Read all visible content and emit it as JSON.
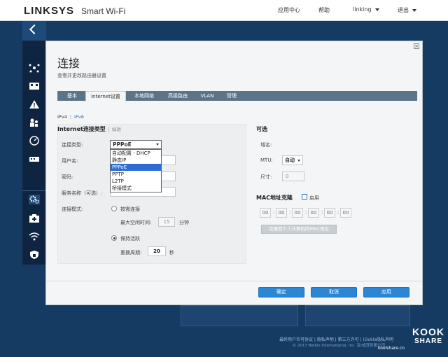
{
  "header": {
    "brand": "LINKSYS",
    "product": "Smart Wi-Fi",
    "nav": {
      "app_center": "应用中心",
      "help": "帮助",
      "user": "linking",
      "logout": "退出"
    }
  },
  "sidebar": {
    "icons": [
      "network-map-icon",
      "devices-icon",
      "alert-icon",
      "parental-icon",
      "speed-icon",
      "media-icon",
      "connectivity-icon",
      "troubleshoot-icon",
      "wireless-icon",
      "security-icon"
    ]
  },
  "modal": {
    "title": "连接",
    "subtitle": "查看并更改路由器设置",
    "close": "×",
    "tabs": [
      {
        "label": "基本"
      },
      {
        "label": "Internet设置"
      },
      {
        "label": "本地网络"
      },
      {
        "label": "高级路由"
      },
      {
        "label": "VLAN"
      },
      {
        "label": "管理"
      }
    ],
    "protocol": {
      "ipv4": "IPv4",
      "ipv6": "IPv6"
    },
    "internet": {
      "title": "Internet连接类型",
      "edit": "编辑",
      "conn_type_label": "连接类型:",
      "conn_type_value": "PPPoE",
      "dropdown_options": [
        "自动配置 - DHCP",
        "静态IP",
        "PPPoE",
        "PPTP",
        "L2TP",
        "桥接模式"
      ],
      "username_label": "用户名:",
      "password_label": "密码:",
      "service_label": "服务名称（可选）:",
      "mode_label": "连接模式:",
      "on_demand": "按需连接",
      "max_idle_label": "最大空闲时间:",
      "max_idle_value": "15",
      "minutes": "分钟",
      "keep_alive": "保持活跃",
      "redial_label": "重拨周期:",
      "redial_value": "20",
      "seconds": "秒"
    },
    "optional": {
      "title": "可选",
      "domain_label": "域名:",
      "mtu_label": "MTU:",
      "mtu_value": "自动",
      "size_label": "尺寸:",
      "size_value": "0"
    },
    "mac_clone": {
      "title": "MAC地址克隆",
      "enable": "启用",
      "octets": [
        "00",
        "00",
        "00",
        "00",
        "00",
        "00"
      ],
      "colon": ":",
      "clone_button": "克隆我个人计算机的MAC地址"
    },
    "buttons": {
      "ok": "确定",
      "cancel": "取消",
      "apply": "应用"
    }
  },
  "footer": {
    "links": "最终用户许可协议 | 隐私声明 | 第三方许可 | (Ookla隐私声明",
    "copyright": "© 2017 Belkin International, Inc. 及/或其附属公司",
    "watermark_top": "KOOK",
    "watermark_bottom": "SHARE",
    "watermark_url": "koolshare.cn"
  }
}
